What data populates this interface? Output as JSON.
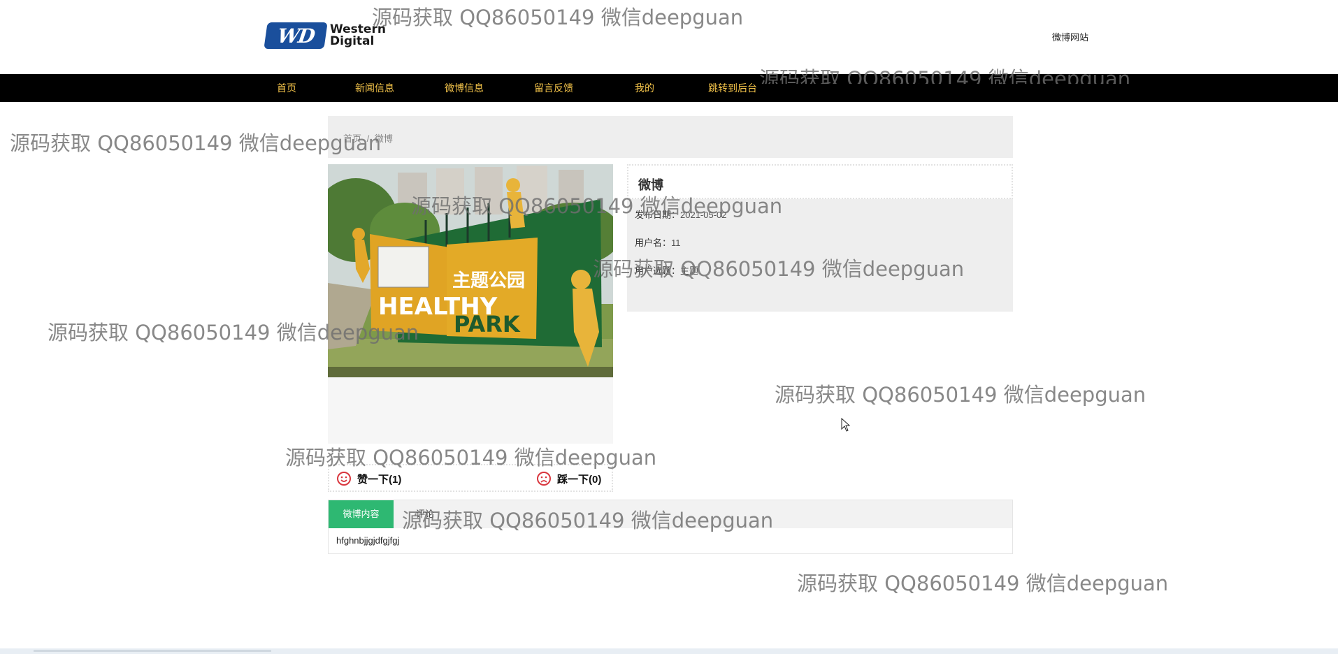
{
  "header": {
    "logo_text_line1": "Western",
    "logo_text_line2": "Digital",
    "logo_badge": "WD",
    "site_name": "微博网站"
  },
  "nav": {
    "items": [
      {
        "label": "首页"
      },
      {
        "label": "新闻信息"
      },
      {
        "label": "微博信息"
      },
      {
        "label": "留言反馈"
      },
      {
        "label": "我的"
      },
      {
        "label": "跳转到后台"
      }
    ]
  },
  "breadcrumb": {
    "home": "首页",
    "separator": "/",
    "current": "微博"
  },
  "post": {
    "title": "微博",
    "date_label": "发布日期：",
    "date_value": "2021-05-02",
    "user_label": "用户名：",
    "user_value": "11",
    "topic_label": "用户选题：",
    "topic_value": "主题",
    "image_sign_text_1": "HEALTHY",
    "image_sign_text_2": "PARK",
    "image_sign_text_3": "主题公园"
  },
  "votes": {
    "like_label": "赞一下(1)",
    "dislike_label": "踩一下(0)"
  },
  "tabs": {
    "active": "微博内容",
    "other": "评论",
    "content": "hfghnbjjgjdfgjfgj"
  },
  "watermark_text": "源码获取 QQ86050149 微信deepguan",
  "colors": {
    "nav_bg": "#000000",
    "nav_text": "#f3c34a",
    "tab_active": "#2eb872",
    "panel_bg": "#eeeeee",
    "logo_blue": "#1a4f9c"
  }
}
